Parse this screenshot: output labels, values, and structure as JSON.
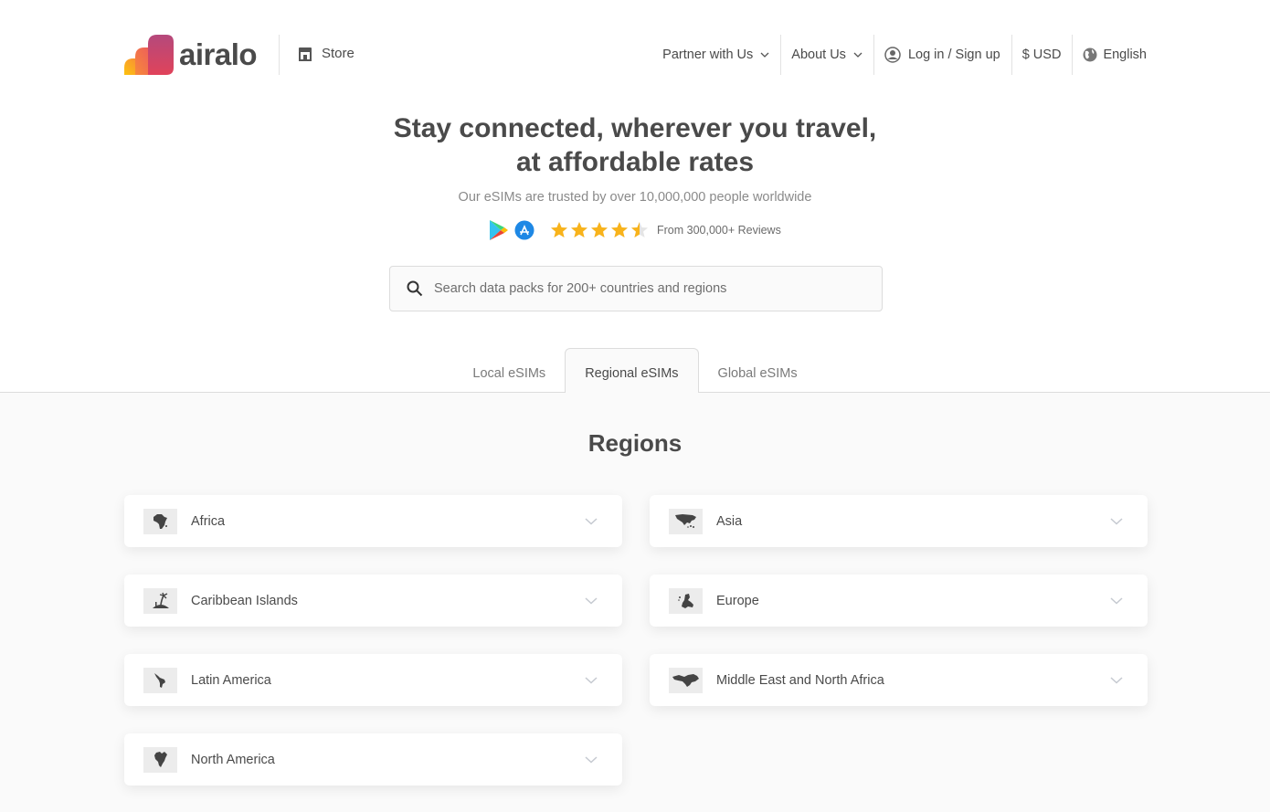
{
  "header": {
    "logo_text": "airalo",
    "store_label": "Store",
    "nav": [
      {
        "label": "Partner with Us",
        "icon": "chevron-down-icon"
      },
      {
        "label": "About Us",
        "icon": "chevron-down-icon"
      },
      {
        "label": "Log in / Sign up",
        "icon": "user-circle-icon"
      },
      {
        "label": "$ USD"
      },
      {
        "label": "English",
        "icon": "globe-icon"
      }
    ]
  },
  "hero": {
    "title_line1": "Stay connected, wherever you travel,",
    "title_line2": "at affordable rates",
    "subtitle": "Our eSIMs are trusted by over 10,000,000 people worldwide",
    "rating": {
      "stars": 4.5,
      "max": 5,
      "reviews_label": "From 300,000+ Reviews"
    },
    "app_stores": [
      "google-play-icon",
      "app-store-icon"
    ]
  },
  "search": {
    "placeholder": "Search data packs for 200+ countries and regions",
    "value": ""
  },
  "tabs": [
    {
      "label": "Local eSIMs",
      "active": false
    },
    {
      "label": "Regional eSIMs",
      "active": true
    },
    {
      "label": "Global eSIMs",
      "active": false
    }
  ],
  "regions": {
    "title": "Regions",
    "items": [
      {
        "label": "Africa",
        "icon": "africa-map-icon"
      },
      {
        "label": "Asia",
        "icon": "asia-map-icon"
      },
      {
        "label": "Caribbean Islands",
        "icon": "island-icon"
      },
      {
        "label": "Europe",
        "icon": "europe-map-icon"
      },
      {
        "label": "Latin America",
        "icon": "latin-america-map-icon"
      },
      {
        "label": "Middle East and North Africa",
        "icon": "mena-map-icon"
      },
      {
        "label": "North America",
        "icon": "north-america-map-icon"
      }
    ]
  },
  "colors": {
    "text": "#4a4a4a",
    "muted": "#8a8a8a",
    "star": "#f8b31b",
    "logo_gradient": [
      "#fdc30f",
      "#f06a4c",
      "#b8467a"
    ]
  }
}
